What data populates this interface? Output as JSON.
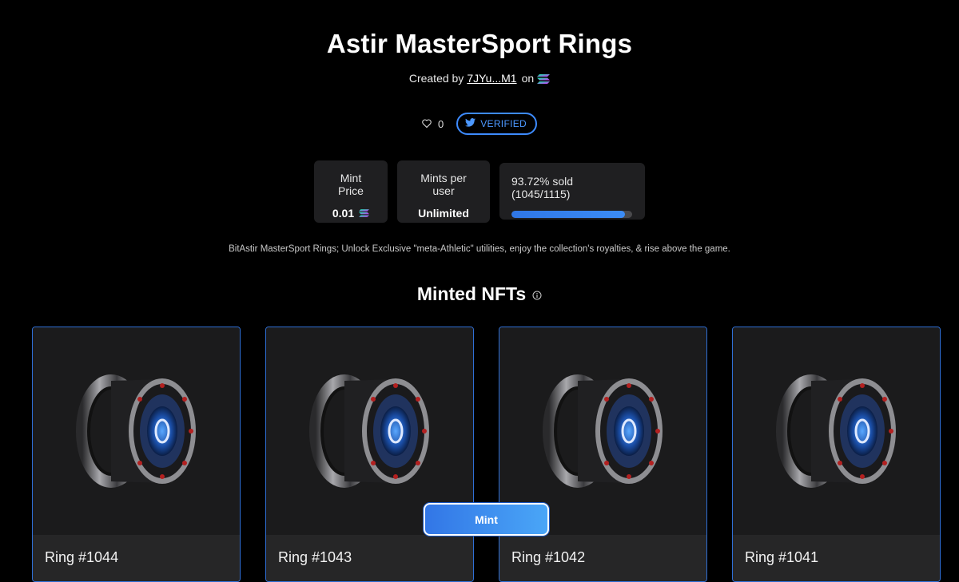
{
  "header": {
    "title": "Astir MasterSport Rings",
    "created_by_prefix": "Created by",
    "creator_address": "7JYu...M1",
    "on_text": "on",
    "chain_icon": "solana-icon"
  },
  "social": {
    "like_count": "0",
    "verified_label": "VERIFIED",
    "verified_icon": "twitter-icon"
  },
  "stats": {
    "mint_price_label": "Mint Price",
    "mint_price_value": "0.01",
    "mints_per_user_label": "Mints per user",
    "mints_per_user_value": "Unlimited",
    "sold_text": "93.72% sold (1045/1115)",
    "sold_fraction": 0.9372
  },
  "description": "BitAstir MasterSport Rings; Unlock Exclusive \"meta-Athletic\" utilities, enjoy the collection's royalties, & rise above the game.",
  "minted_section": {
    "title": "Minted NFTs",
    "info_icon": "info-icon"
  },
  "nfts": [
    {
      "name": "Ring #1044"
    },
    {
      "name": "Ring #1043"
    },
    {
      "name": "Ring #1042"
    },
    {
      "name": "Ring #1041"
    }
  ],
  "mint_button": {
    "label": "Mint"
  },
  "colors": {
    "accent": "#3d8bff",
    "card_bg": "#1f1f21",
    "background": "#000000"
  }
}
